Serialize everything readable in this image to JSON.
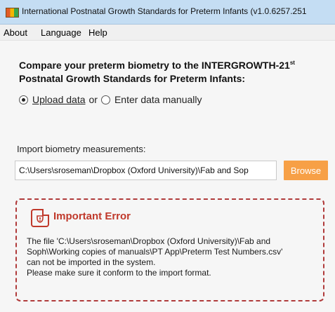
{
  "window": {
    "title": "International Postnatal Growth Standards for Preterm Infants (v1.0.6257.251"
  },
  "menu": {
    "items": [
      "About",
      "Language",
      "Help"
    ]
  },
  "heading": {
    "line1_pre": "Compare your preterm biometry to the INTERGROWTH-21",
    "line1_sup": "st",
    "line2": "Postnatal Growth Standards for Preterm Infants:"
  },
  "mode": {
    "upload_label": "Upload data",
    "separator": "or",
    "manual_label": "Enter data manually",
    "selected": "upload"
  },
  "import": {
    "label": "Import biometry measurements:",
    "path_value": "C:\\Users\\sroseman\\Dropbox (Oxford University)\\Fab and Sop",
    "browse_label": "Browse"
  },
  "error": {
    "title": "Important Error",
    "lines": [
      "The file 'C:\\Users\\sroseman\\Dropbox (Oxford University)\\Fab and",
      "Soph\\Working copies of manuals\\PT App\\Preterm Test Numbers.csv'",
      "can not be imported in the system.",
      "Please make sure it conform to the import format."
    ]
  },
  "colors": {
    "accent": "#f7a046",
    "error": "#c0392b",
    "titlebar": "#c4ddf3"
  },
  "icons": {
    "app": "app-logo-icon",
    "error": "document-error-icon"
  }
}
